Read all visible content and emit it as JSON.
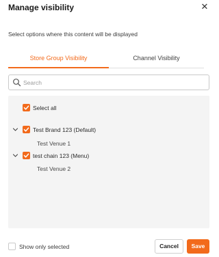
{
  "dialog": {
    "title": "Manage visibility",
    "close_icon": "close-icon",
    "description": "Select options where this content will be displayed"
  },
  "tabs": [
    {
      "label": "Store Group Visibility",
      "active": true
    },
    {
      "label": "Channel Visibility",
      "active": false
    }
  ],
  "search": {
    "placeholder": "Search",
    "value": ""
  },
  "tree": {
    "select_all": {
      "label": "Select all",
      "checked": true
    },
    "groups": [
      {
        "label": "Test Brand 123 (Default)",
        "checked": true,
        "expanded": true,
        "children": [
          "Test Venue 1"
        ]
      },
      {
        "label": "test chain 123 (Menu)",
        "checked": true,
        "expanded": true,
        "children": [
          "Test Venue 2"
        ]
      }
    ]
  },
  "footer": {
    "show_only_selected": {
      "label": "Show only selected",
      "checked": false
    },
    "cancel_label": "Cancel",
    "save_label": "Save"
  },
  "colors": {
    "accent": "#f26a1b",
    "panel_bg": "#f4f4f4"
  }
}
